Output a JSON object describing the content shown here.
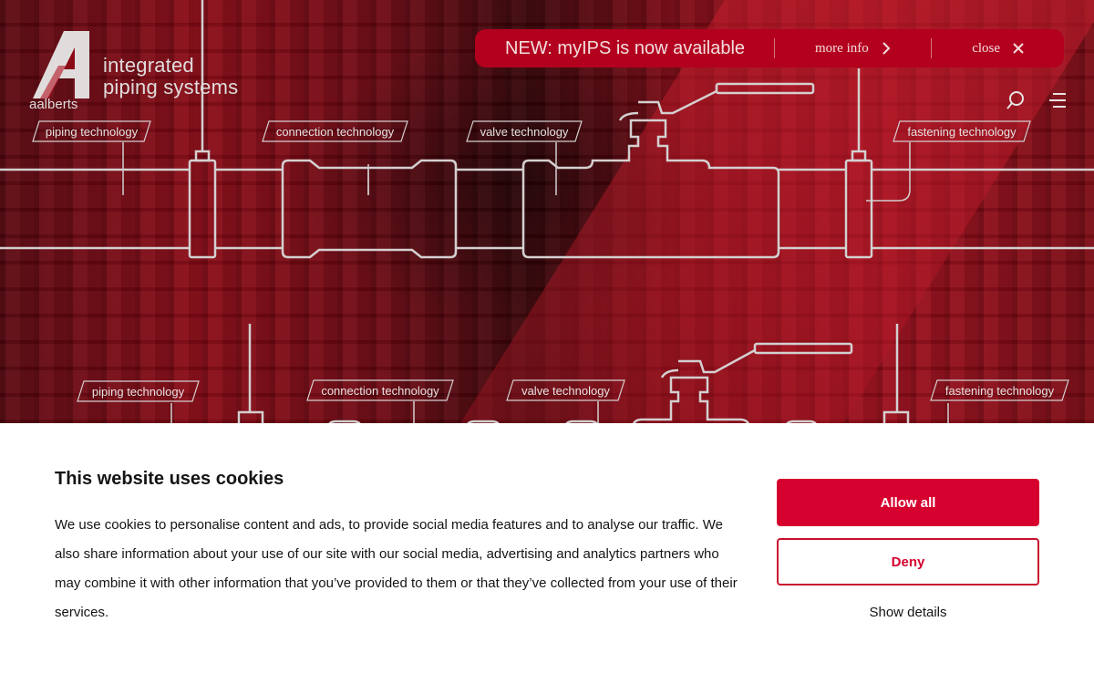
{
  "brand": {
    "name": "aalberts",
    "tagline_line1": "integrated",
    "tagline_line2": "piping systems"
  },
  "announcement": {
    "title": "NEW: myIPS is now available",
    "more_info": "more info",
    "close": "close"
  },
  "header": {
    "search_icon": "search-icon",
    "menu_icon": "hamburger-menu-icon"
  },
  "technologies_row1": [
    "piping technology",
    "connection technology",
    "valve technology",
    "fastening technology"
  ],
  "technologies_row2": [
    "piping technology",
    "connection technology",
    "valve technology",
    "fastening technology"
  ],
  "cookie": {
    "title": "This website uses cookies",
    "body": "We use cookies to personalise content and ads, to provide social media features and to analyse our traffic. We also share information about your use of our site with our social media, advertising and analytics partners who may combine it with other information that you’ve provided to them or that they’ve collected from your use of their services.",
    "allow_label": "Allow all",
    "deny_label": "Deny",
    "details_label": "Show details"
  },
  "colors": {
    "brand_red": "#d6002e",
    "announcement_bg": "#b3001f",
    "pipe_stroke": "#d4d0d0"
  }
}
